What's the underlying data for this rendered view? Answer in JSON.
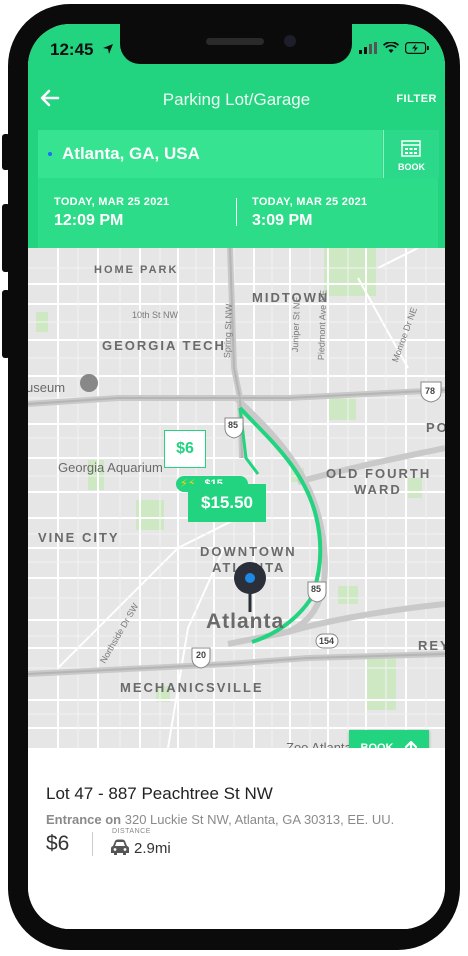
{
  "status_bar": {
    "time": "12:45"
  },
  "nav": {
    "title": "Parking Lot/Garage",
    "filter_label": "FILTER"
  },
  "search": {
    "location": "Atlanta, GA, USA",
    "book_label": "BOOK",
    "start": {
      "date": "TODAY, MAR 25 2021",
      "time": "12:09 PM"
    },
    "end": {
      "date": "TODAY, MAR 25 2021",
      "time": "3:09 PM"
    }
  },
  "map": {
    "labels": {
      "home_park": "HOME PARK",
      "midtown": "MIDTOWN",
      "georgia_tech": "GEORGIA TECH",
      "museum": "useum",
      "georgia_aquarium": "Georgia Aquarium",
      "old_fourth_ward_1": "OLD FOURTH",
      "old_fourth_ward_2": "WARD",
      "vine_city": "VINE CITY",
      "downtown_1": "DOWNTOWN",
      "downtown_2": "ATLANTA",
      "atlanta": "Atlanta",
      "mechanicsville": "MECHANICSVILLE",
      "zoo_atlanta": "Zoo Atlanta",
      "tenth_st": "10th St NW",
      "spring_st": "Spring St NW",
      "juniper_st": "Juniper St NE",
      "piedmont": "Piedmont Ave NE",
      "monroe_dr": "Monroe Dr NE",
      "northside_dr": "Northside Dr SW",
      "po": "PO",
      "rey": "REY",
      "hwy_78": "78",
      "hwy_85a": "85",
      "hwy_85b": "85",
      "hwy_20": "20",
      "hwy_154": "154"
    },
    "markers": [
      {
        "price": "$6"
      },
      {
        "price": "$15.50"
      },
      {
        "price": "$15"
      }
    ],
    "book_label": "BOOK"
  },
  "lot": {
    "name": "Lot 47 - 887 Peachtree St NW",
    "entrance_label": "Entrance on",
    "entrance_address": "320 Luckie St NW, Atlanta, GA 30313, EE. UU.",
    "price": "$6",
    "distance_label": "DISTANCE",
    "distance": "2.9mi"
  },
  "colors": {
    "brand_green": "#22d37f",
    "pin_blue": "#1e88e5"
  },
  "icons": [
    "back-arrow-icon",
    "calendar-icon",
    "location-pin-icon",
    "lightning-icon",
    "car-icon",
    "up-arrow-icon",
    "paw-icon",
    "museum-icon",
    "wifi-icon",
    "battery-icon",
    "signal-icon",
    "location-arrow-icon"
  ]
}
